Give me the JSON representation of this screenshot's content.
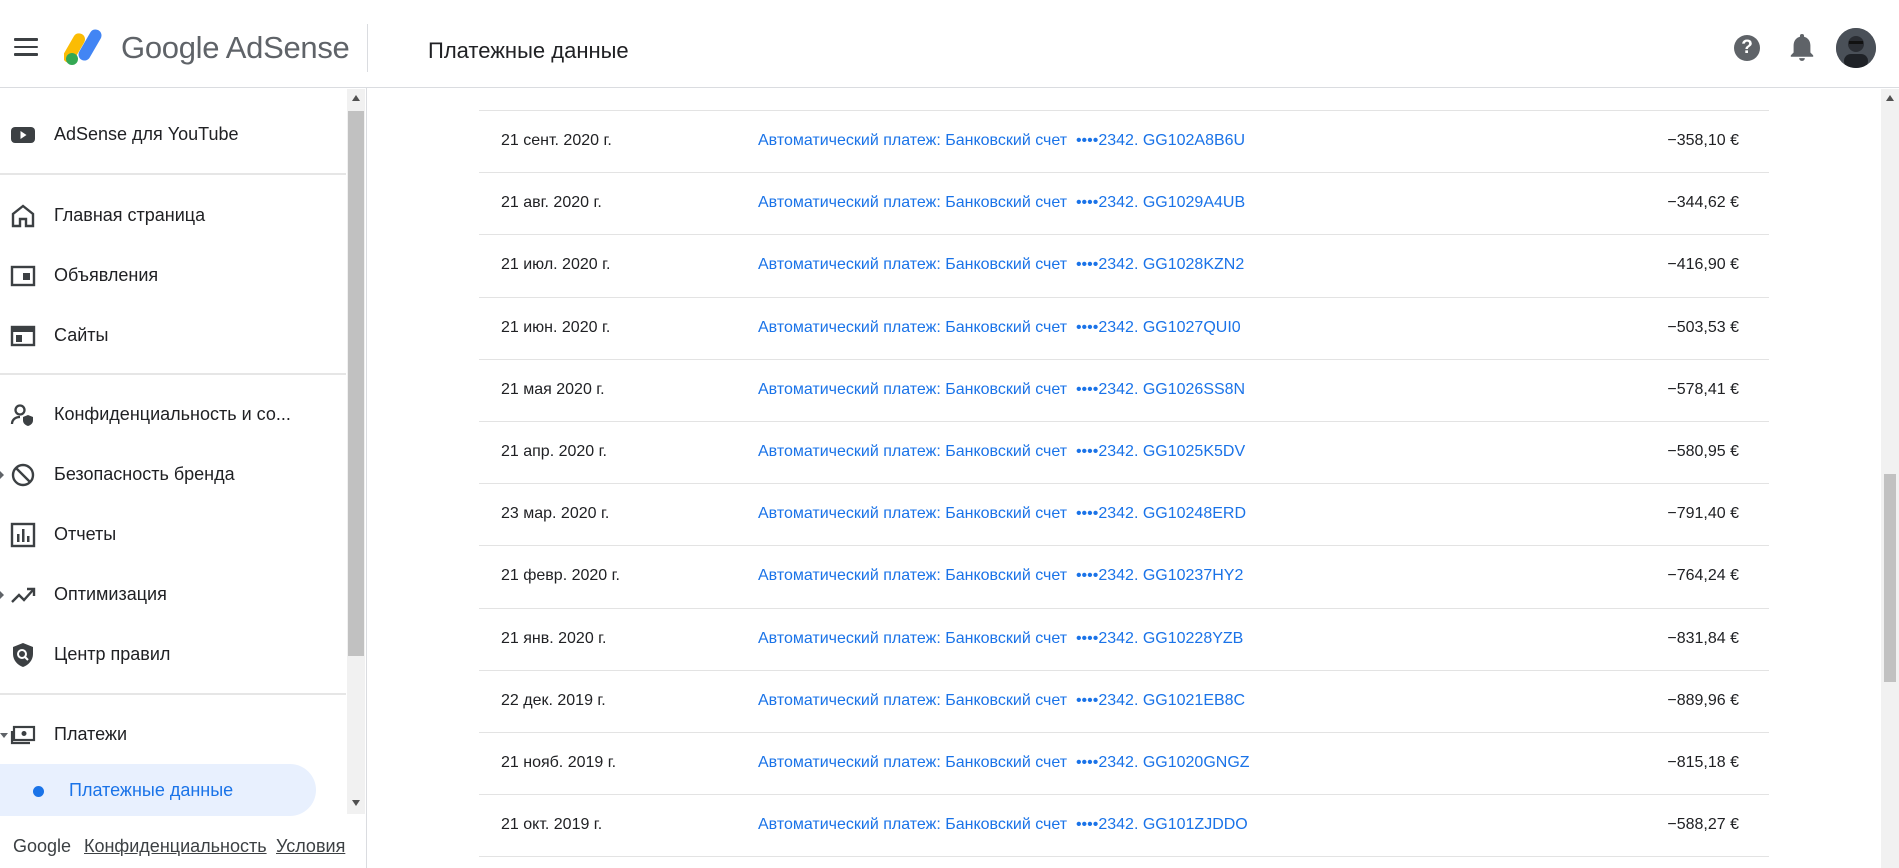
{
  "header": {
    "brand": "Google AdSense",
    "page_title": "Платежные данные"
  },
  "sidebar": {
    "items": [
      {
        "label": "AdSense для YouTube",
        "icon": "youtube-icon"
      },
      {
        "label": "Главная страница",
        "icon": "home-icon"
      },
      {
        "label": "Объявления",
        "icon": "ads-icon"
      },
      {
        "label": "Сайты",
        "icon": "sites-icon"
      },
      {
        "label": "Конфиденциальность и со...",
        "icon": "privacy-icon"
      },
      {
        "label": "Безопасность бренда",
        "icon": "block-icon"
      },
      {
        "label": "Отчеты",
        "icon": "reports-icon"
      },
      {
        "label": "Оптимизация",
        "icon": "trending-icon"
      },
      {
        "label": "Центр правил",
        "icon": "policy-shield-icon"
      },
      {
        "label": "Платежи",
        "icon": "payments-icon"
      },
      {
        "label": "Платежные данные",
        "icon": "dot-icon",
        "active": true
      }
    ]
  },
  "footer": {
    "brand": "Google",
    "privacy": "Конфиденциальность",
    "terms": "Условия"
  },
  "transactions": [
    {
      "date": "21 сент. 2020 г.",
      "description": "Автоматический платеж: Банковский счет  ••••2342. GG102A8B6U",
      "amount": "−358,10 €"
    },
    {
      "date": "21 авг. 2020 г.",
      "description": "Автоматический платеж: Банковский счет  ••••2342. GG1029A4UB",
      "amount": "−344,62 €"
    },
    {
      "date": "21 июл. 2020 г.",
      "description": "Автоматический платеж: Банковский счет  ••••2342. GG1028KZN2",
      "amount": "−416,90 €"
    },
    {
      "date": "21 июн. 2020 г.",
      "description": "Автоматический платеж: Банковский счет  ••••2342. GG1027QUI0",
      "amount": "−503,53 €"
    },
    {
      "date": "21 мая 2020 г.",
      "description": "Автоматический платеж: Банковский счет  ••••2342. GG1026SS8N",
      "amount": "−578,41 €"
    },
    {
      "date": "21 апр. 2020 г.",
      "description": "Автоматический платеж: Банковский счет  ••••2342. GG1025K5DV",
      "amount": "−580,95 €"
    },
    {
      "date": "23 мар. 2020 г.",
      "description": "Автоматический платеж: Банковский счет  ••••2342. GG10248ERD",
      "amount": "−791,40 €"
    },
    {
      "date": "21 февр. 2020 г.",
      "description": "Автоматический платеж: Банковский счет  ••••2342. GG10237HY2",
      "amount": "−764,24 €"
    },
    {
      "date": "21 янв. 2020 г.",
      "description": "Автоматический платеж: Банковский счет  ••••2342. GG10228YZB",
      "amount": "−831,84 €"
    },
    {
      "date": "22 дек. 2019 г.",
      "description": "Автоматический платеж: Банковский счет  ••••2342. GG1021EB8C",
      "amount": "−889,96 €"
    },
    {
      "date": "21 нояб. 2019 г.",
      "description": "Автоматический платеж: Банковский счет  ••••2342. GG1020GNGZ",
      "amount": "−815,18 €"
    },
    {
      "date": "21 окт. 2019 г.",
      "description": "Автоматический платеж: Банковский счет  ••••2342. GG101ZJDDO",
      "amount": "−588,27 €"
    }
  ],
  "colors": {
    "link": "#1a73e8",
    "active_bg": "#e8f0fe",
    "logo_yellow": "#fbbc04",
    "logo_blue": "#4285f4",
    "logo_green": "#34a853"
  }
}
